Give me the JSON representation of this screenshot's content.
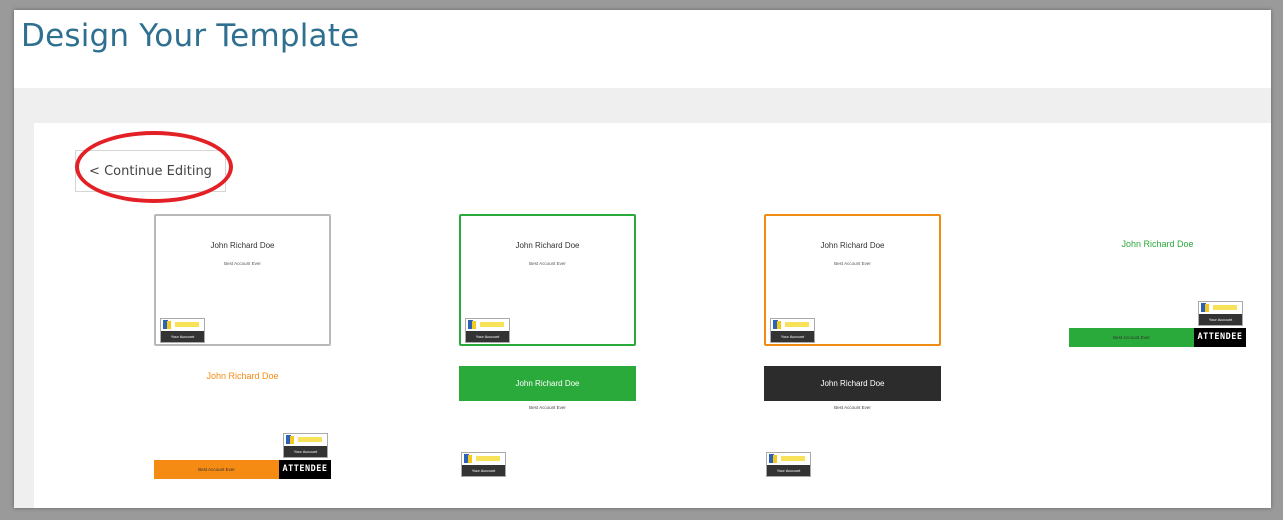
{
  "page": {
    "title": "Design Your Template"
  },
  "toolbar": {
    "continue_label": "< Continue Editing"
  },
  "colors": {
    "green": "#2aaa3a",
    "orange": "#f58b13",
    "dark": "#2c2c2c",
    "title_blue": "#2f6f8f",
    "highlight_red": "#e32025"
  },
  "templates": [
    {
      "name": "John Richard Doe",
      "subtitle": "Best Account Ever",
      "logo_label": "Your Account"
    },
    {
      "name": "John Richard Doe",
      "subtitle": "Best Account Ever",
      "logo_label": "Your Account"
    },
    {
      "name": "John Richard Doe",
      "subtitle": "Best Account Ever",
      "logo_label": "Your Account"
    },
    {
      "name": "John Richard Doe",
      "subtitle": "Best Account Ever",
      "logo_label": "Your Account",
      "badge": "ATTENDEE"
    },
    {
      "name": "John Richard Doe",
      "subtitle": "Best Account Ever",
      "logo_label": "Your Account",
      "badge": "ATTENDEE"
    },
    {
      "name": "John Richard Doe",
      "subtitle": "Best Account Ever",
      "logo_label": "Your Account"
    },
    {
      "name": "John Richard Doe",
      "subtitle": "Best Account Ever",
      "logo_label": "Your Account"
    }
  ]
}
